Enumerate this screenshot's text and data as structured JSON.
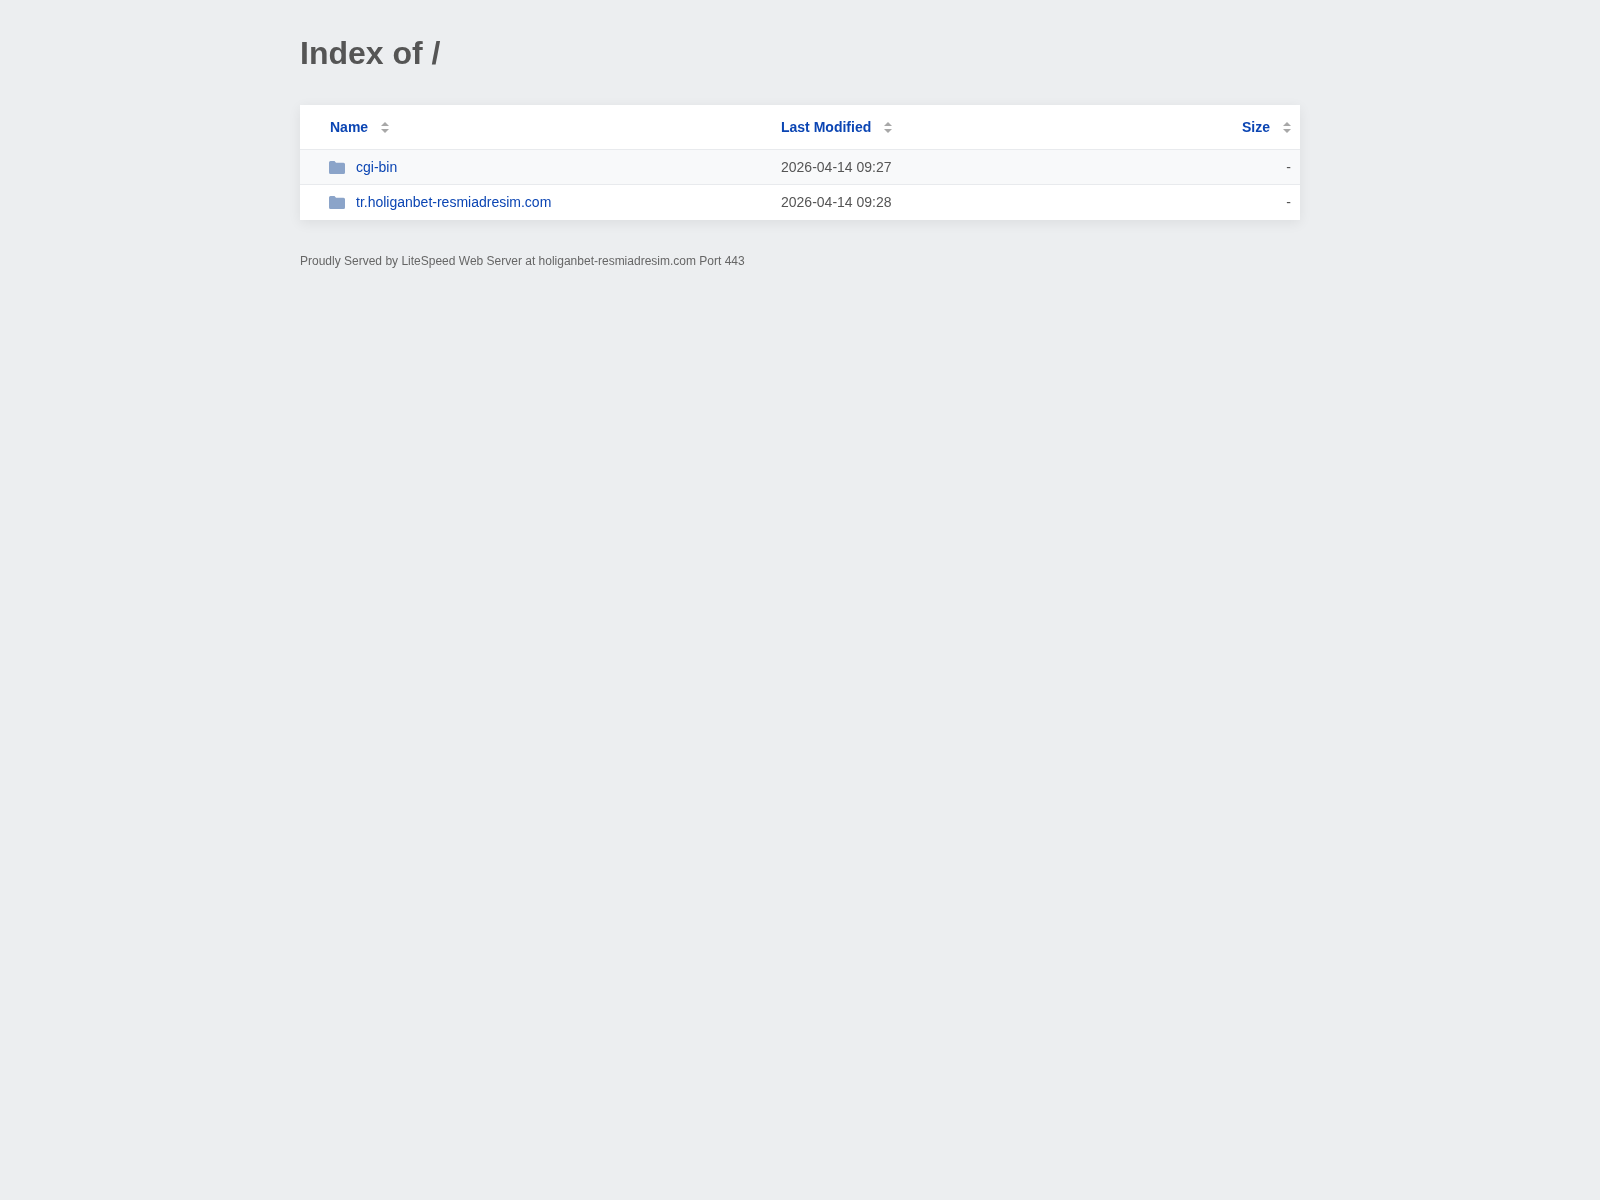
{
  "title": "Index of /",
  "table": {
    "columns": [
      "Name",
      "Last Modified",
      "Size"
    ],
    "rows": [
      {
        "kind": "folder",
        "name": "cgi-bin",
        "last_modified": "2026-04-14 09:27",
        "size": "-"
      },
      {
        "kind": "folder",
        "name": "tr.holiganbet-resmiadresim.com",
        "last_modified": "2026-04-14 09:28",
        "size": "-"
      }
    ]
  },
  "footer": "Proudly Served by LiteSpeed Web Server at holiganbet-resmiadresim.com Port 443"
}
